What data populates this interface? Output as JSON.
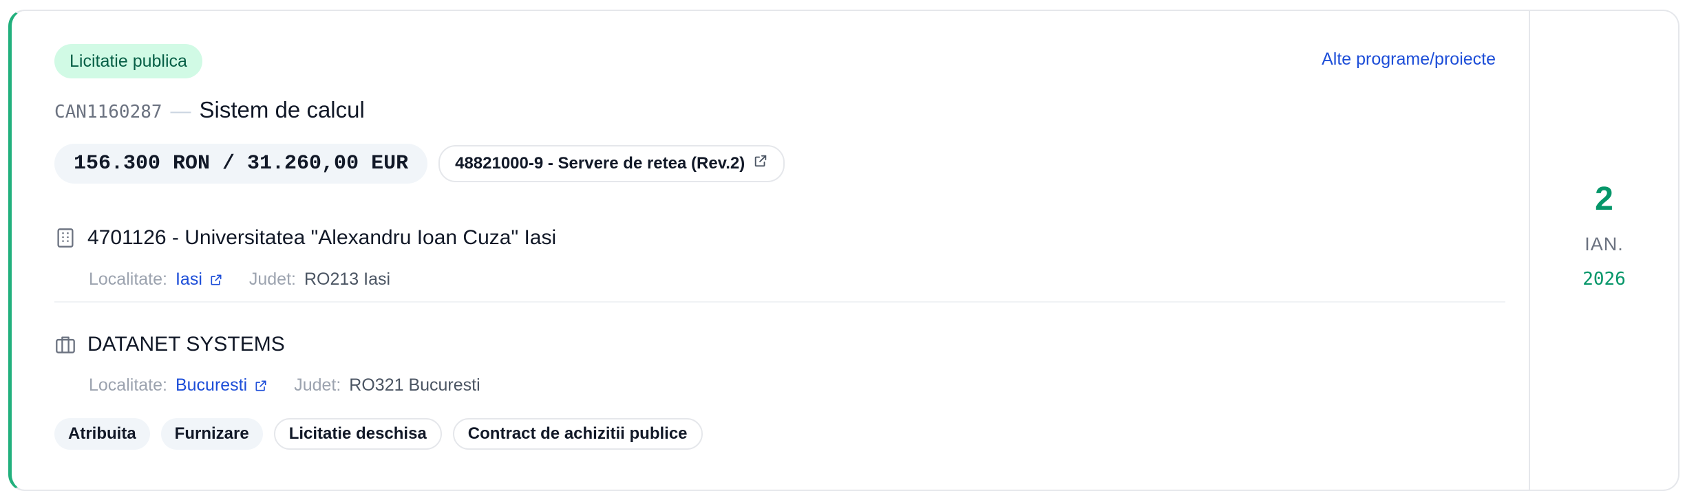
{
  "procedure_type": "Licitatie publica",
  "other_link": "Alte programe/proiecte",
  "notice": {
    "code": "CAN1160287",
    "separator": "—",
    "title": "Sistem de calcul"
  },
  "value": "156.300 RON / 31.260,00 EUR",
  "cpv": "48821000-9 - Servere de retea (Rev.2)",
  "authority": {
    "name": "4701126 - Universitatea \"Alexandru Ioan Cuza\" Iasi",
    "locality_label": "Localitate:",
    "locality": "Iasi",
    "county_label": "Judet:",
    "county": "RO213 Iasi",
    "icon": "building-icon"
  },
  "supplier": {
    "name": "DATANET SYSTEMS",
    "locality_label": "Localitate:",
    "locality": "Bucuresti",
    "county_label": "Judet:",
    "county": "RO321 Bucuresti",
    "icon": "briefcase-icon"
  },
  "tags": [
    "Atribuita",
    "Furnizare",
    "Licitatie deschisa",
    "Contract de achizitii publice"
  ],
  "date": {
    "day": "2",
    "month": "IAN.",
    "year": "2026"
  },
  "colors": {
    "accent": "#22b07d",
    "date": "#059669",
    "link": "#1d4ed8",
    "pill_bg": "#d1fae5"
  }
}
